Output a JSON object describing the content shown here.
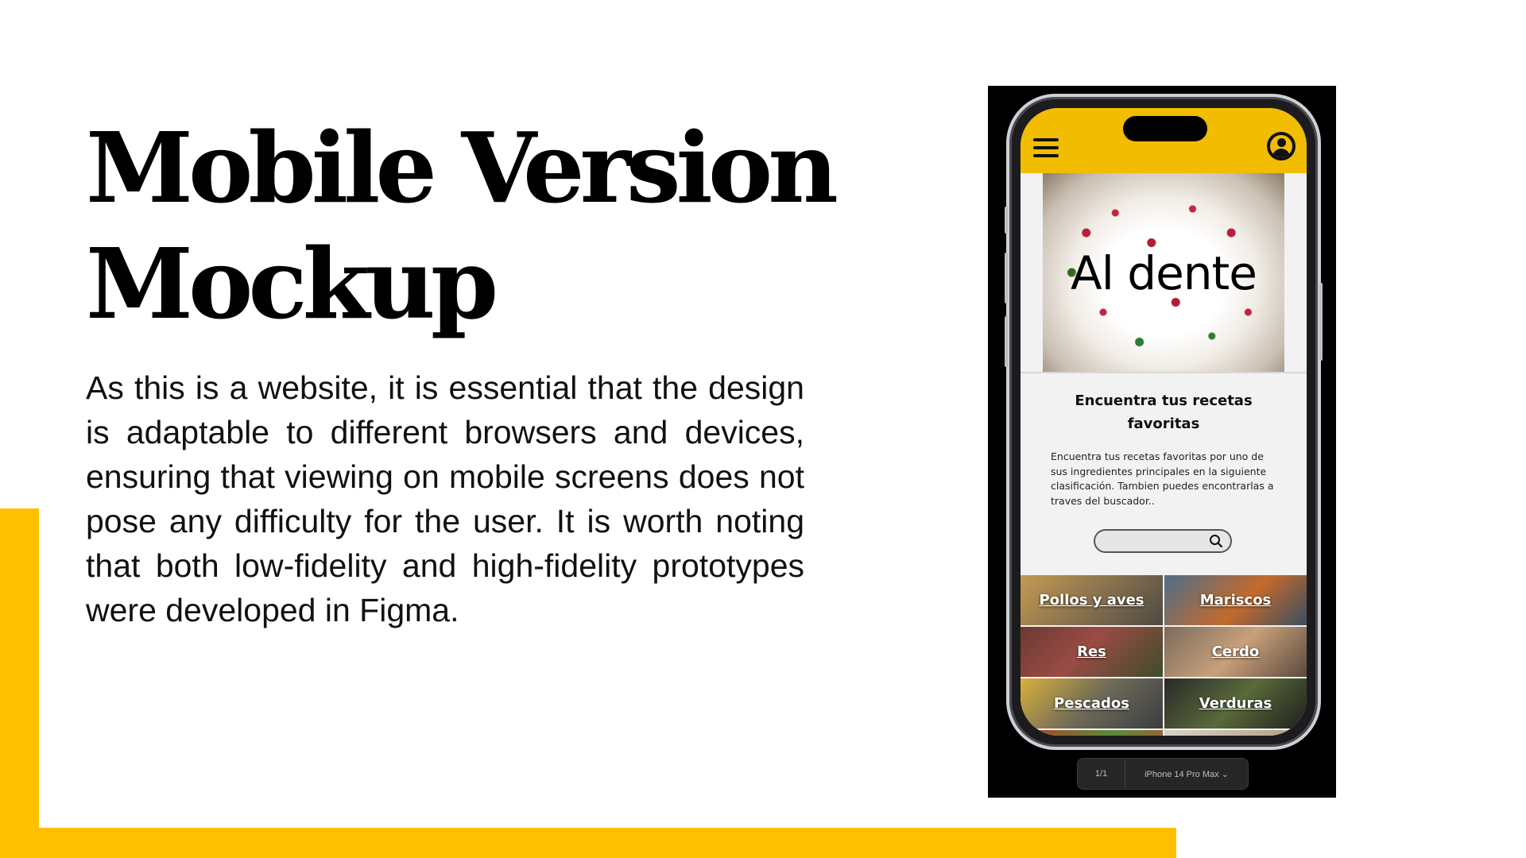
{
  "slide": {
    "title_line1": "Mobile Version",
    "title_line2": "Mockup",
    "body": "As this is a website, it is essential that the design is adaptable to different browsers and devices, ensuring that viewing on mobile screens does not pose any difficulty for the user. It is worth noting that both low-fidelity and high-fidelity prototypes were developed in Figma.",
    "accent_color": "#FFC000"
  },
  "app": {
    "header_color": "#F2BC00",
    "menu_icon": "hamburger-menu-icon",
    "profile_icon": "user-profile-icon",
    "hero_title": "Al dente",
    "intro_title": "Encuentra tus recetas favoritas",
    "intro_text": "Encuentra tus recetas favoritas por uno de sus ingredientes principales en la siguiente clasificación. Tambien puedes encontrarlas a traves del buscador..",
    "search_icon": "search-icon",
    "categories": [
      {
        "label": "Pollos y aves"
      },
      {
        "label": "Mariscos"
      },
      {
        "label": "Res"
      },
      {
        "label": "Cerdo"
      },
      {
        "label": "Pescados"
      },
      {
        "label": "Verduras"
      }
    ]
  },
  "figma_toolbar": {
    "page_indicator": "1/1",
    "device": "iPhone 14 Pro Max",
    "dropdown_icon": "chevron-down-icon"
  }
}
